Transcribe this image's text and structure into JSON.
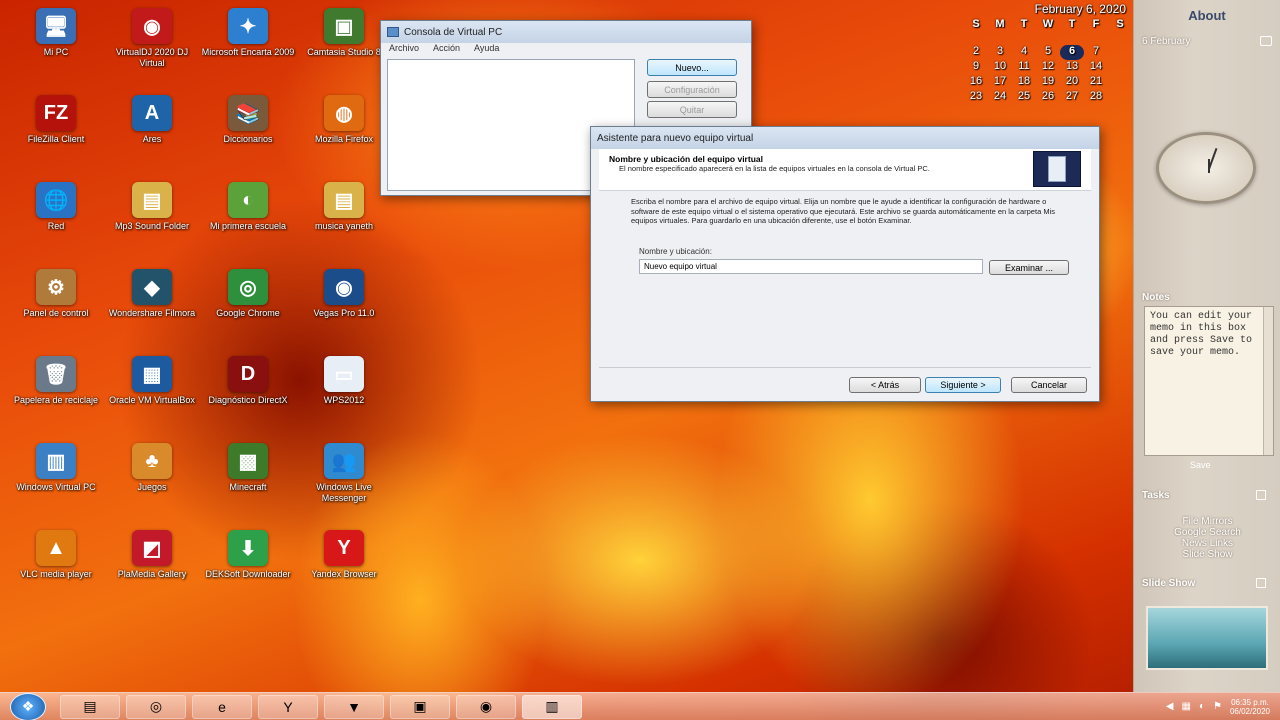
{
  "desktop": {
    "icons": [
      {
        "label": "Mi PC",
        "icon": "computer-icon",
        "glyph": "🖥",
        "color": "#3a6fb5"
      },
      {
        "label": "VirtualDJ 2020 DJ Virtual",
        "icon": "virtualdj-icon",
        "glyph": "◉",
        "color": "#c21a1a"
      },
      {
        "label": "Microsoft Encarta 2009",
        "icon": "encarta-icon",
        "glyph": "✦",
        "color": "#2d7fd0"
      },
      {
        "label": "Camtasia Studio 8",
        "icon": "camtasia-icon",
        "glyph": "▣",
        "color": "#3f7a2f"
      },
      {
        "label": "FileZilla Client",
        "icon": "filezilla-icon",
        "glyph": "FZ",
        "color": "#b5120c"
      },
      {
        "label": "Ares",
        "icon": "ares-icon",
        "glyph": "A",
        "color": "#1f63a8"
      },
      {
        "label": "Diccionarios",
        "icon": "books-icon",
        "glyph": "📚",
        "color": "#7a5a3a"
      },
      {
        "label": "Mozilla Firefox",
        "icon": "firefox-icon",
        "glyph": "◍",
        "color": "#e06a0f"
      },
      {
        "label": "Red",
        "icon": "network-icon",
        "glyph": "🌐",
        "color": "#2a73c4"
      },
      {
        "label": "Mp3 Sound Folder",
        "icon": "folder-icon",
        "glyph": "▤",
        "color": "#d9b34a"
      },
      {
        "label": "Mi primera escuela",
        "icon": "school-icon",
        "glyph": "◐",
        "color": "#5ba23b"
      },
      {
        "label": "musica yaneth",
        "icon": "folder-icon",
        "glyph": "▤",
        "color": "#d9b34a"
      },
      {
        "label": "Panel de control",
        "icon": "control-panel-icon",
        "glyph": "⚙",
        "color": "#b07a3a"
      },
      {
        "label": "Wondershare Filmora",
        "icon": "filmora-icon",
        "glyph": "◆",
        "color": "#23536a"
      },
      {
        "label": "Google Chrome",
        "icon": "chrome-icon",
        "glyph": "◎",
        "color": "#2e8f3c"
      },
      {
        "label": "Vegas Pro 11.0",
        "icon": "vegas-icon",
        "glyph": "◉",
        "color": "#1a4d8a"
      },
      {
        "label": "Papelera de reciclaje",
        "icon": "recycle-bin-icon",
        "glyph": "🗑",
        "color": "#6b7a8a"
      },
      {
        "label": "Oracle VM VirtualBox",
        "icon": "virtualbox-icon",
        "glyph": "▦",
        "color": "#1e5aa0"
      },
      {
        "label": "Diagnóstico DirectX",
        "icon": "directx-icon",
        "glyph": "D",
        "color": "#8a1010"
      },
      {
        "label": "WPS2012",
        "icon": "document-icon",
        "glyph": "▭",
        "color": "#e8eef6"
      },
      {
        "label": "Windows Virtual PC",
        "icon": "virtual-pc-icon",
        "glyph": "▥",
        "color": "#3b7fc4"
      },
      {
        "label": "Juegos",
        "icon": "games-icon",
        "glyph": "♣",
        "color": "#d98a2a"
      },
      {
        "label": "Minecraft",
        "icon": "minecraft-icon",
        "glyph": "▩",
        "color": "#3d7a2a"
      },
      {
        "label": "Windows Live Messenger",
        "icon": "messenger-icon",
        "glyph": "👥",
        "color": "#2f8ad0"
      },
      {
        "label": "VLC media player",
        "icon": "vlc-icon",
        "glyph": "▲",
        "color": "#e07a10"
      },
      {
        "label": "PlaMedia Gallery",
        "icon": "media-gallery-icon",
        "glyph": "◩",
        "color": "#c21a2a"
      },
      {
        "label": "DEKSoft Downloader",
        "icon": "downloader-icon",
        "glyph": "⬇",
        "color": "#2fa04a"
      },
      {
        "label": "Yandex Browser",
        "icon": "yandex-icon",
        "glyph": "Y",
        "color": "#d81818"
      }
    ]
  },
  "console": {
    "title": "Consola de Virtual PC",
    "menu": [
      "Archivo",
      "Acción",
      "Ayuda"
    ],
    "buttons": {
      "new": "Nuevo...",
      "settings": "Configuración",
      "remove": "Quitar"
    }
  },
  "wizard": {
    "title": "Asistente para nuevo equipo virtual",
    "heading": "Nombre y ubicación del equipo virtual",
    "subheading": "El nombre especificado aparecerá en la lista de equipos virtuales en la consola de Virtual PC.",
    "description": "Escriba el nombre para el archivo de equipo virtual. Elija un nombre que le ayude a identificar la configuración de hardware o software de este equipo virtual o el sistema operativo que ejecutará. Este archivo se guarda automáticamente en la carpeta Mis equipos virtuales. Para guardarlo en una ubicación diferente, use el botón Examinar.",
    "field_label": "Nombre y ubicación:",
    "field_value": "Nuevo equipo virtual",
    "browse": "Examinar ...",
    "back": "< Atrás",
    "next": "Siguiente >",
    "cancel": "Cancelar"
  },
  "calendar": {
    "title": "February 6, 2020",
    "weekdays": [
      "S",
      "M",
      "T",
      "W",
      "T",
      "F",
      "S"
    ],
    "rows": [
      [
        "",
        "",
        "",
        "",
        "",
        "",
        ""
      ],
      [
        "2",
        "3",
        "4",
        "5",
        "6",
        "7",
        ""
      ],
      [
        "9",
        "10",
        "11",
        "12",
        "13",
        "14",
        ""
      ],
      [
        "16",
        "17",
        "18",
        "19",
        "20",
        "21",
        ""
      ],
      [
        "23",
        "24",
        "25",
        "26",
        "27",
        "28",
        ""
      ]
    ],
    "today": "6"
  },
  "sidebar": {
    "about": "About",
    "date_label": "6 February",
    "notes_title": "Notes",
    "notes_text": "You can edit your memo in this box and press Save to save your memo.",
    "save_label": "Save",
    "tasks_title": "Tasks",
    "tasks": [
      "File Mirrors",
      "Google Search",
      "News Links",
      "Slide Show"
    ],
    "slideshow_title": "Slide Show"
  },
  "taskbar": {
    "apps": [
      {
        "name": "explorer",
        "glyph": "▤",
        "icon": "folder-icon"
      },
      {
        "name": "chrome",
        "glyph": "◎",
        "icon": "chrome-icon"
      },
      {
        "name": "ie",
        "glyph": "e",
        "icon": "internet-explorer-icon"
      },
      {
        "name": "yandex",
        "glyph": "Y",
        "icon": "yandex-icon"
      },
      {
        "name": "brave",
        "glyph": "▼",
        "icon": "brave-icon"
      },
      {
        "name": "camtasia",
        "glyph": "▣",
        "icon": "camtasia-icon"
      },
      {
        "name": "recorder",
        "glyph": "◉",
        "icon": "recorder-icon"
      },
      {
        "name": "virtual-pc",
        "glyph": "▥",
        "icon": "virtual-pc-icon"
      }
    ],
    "clock_time": "06:35 p.m.",
    "clock_date": "06/02/2020"
  },
  "colors": {
    "accent": "#3c7fb1",
    "wizard_header": "#ffffff",
    "calendar_today": "#1a2a5a"
  }
}
